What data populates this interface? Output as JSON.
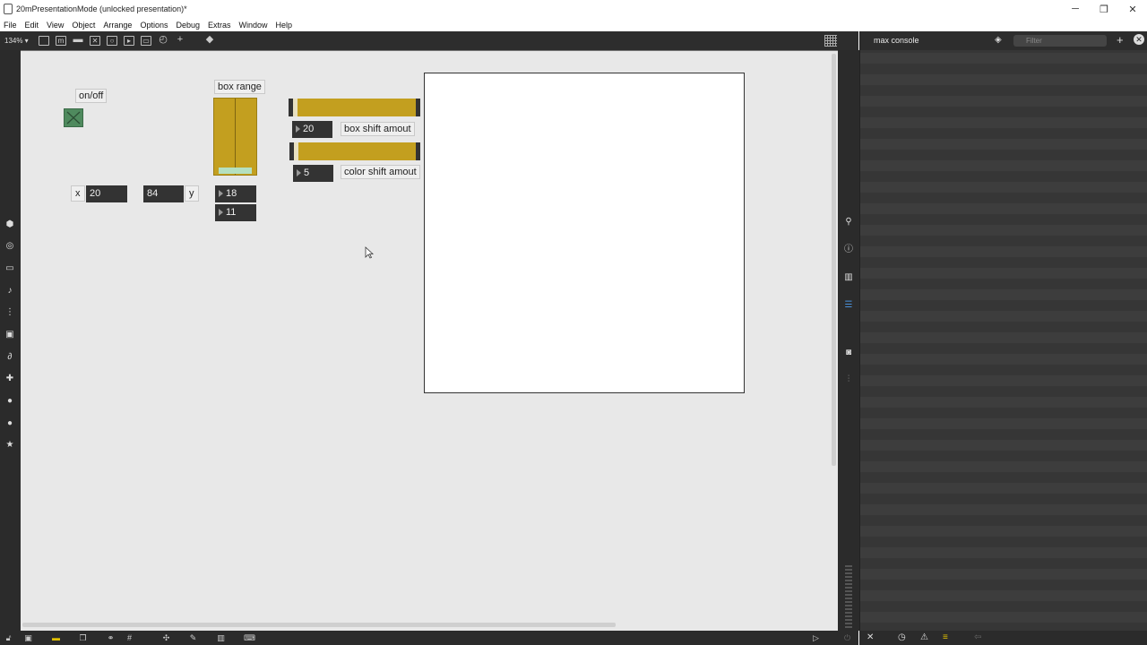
{
  "window": {
    "title": "20mPresentationMode (unlocked presentation)*",
    "controls": {
      "minimize": "─",
      "restore": "❐",
      "close": "✕"
    }
  },
  "menu": [
    "File",
    "Edit",
    "View",
    "Object",
    "Arrange",
    "Options",
    "Debug",
    "Extras",
    "Window",
    "Help"
  ],
  "toolbar": {
    "zoom": "134% ▾",
    "icons": [
      "presentation-icon",
      "message-icon",
      "comment-icon",
      "toggle-icon",
      "button-icon",
      "slider-icon",
      "number-icon",
      "help-icon",
      "add-icon",
      "paint-bucket-icon",
      "grid-icon"
    ]
  },
  "patcher": {
    "onoff_label": "on/off",
    "box_range_label": "box range",
    "x_label": "x",
    "y_label": "y",
    "x_value": "20",
    "y_value": "84",
    "range_low": "18",
    "range_high": "11",
    "box_shift_value": "20",
    "box_shift_label": "box shift amout",
    "color_shift_value": "5",
    "color_shift_label": "color shift amout"
  },
  "console": {
    "title": "max console",
    "filter_placeholder": "Filter"
  },
  "colors": {
    "slider_fill": "#c39f1f",
    "toggle_on": "#4f8a5e",
    "chrome_dark": "#2b2b2b",
    "canvas_bg": "#e8e8e8"
  }
}
